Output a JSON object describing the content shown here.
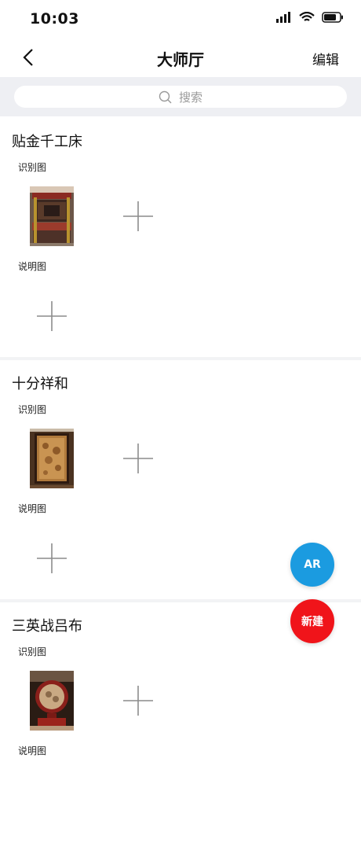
{
  "status_bar": {
    "time": "10:03"
  },
  "nav": {
    "title": "大师厅",
    "edit_label": "编辑"
  },
  "search": {
    "placeholder": "搜索"
  },
  "sections": [
    {
      "title": "贴金千工床",
      "recognition_label": "识别图",
      "description_label": "说明图"
    },
    {
      "title": "十分祥和",
      "recognition_label": "识别图",
      "description_label": "说明图"
    },
    {
      "title": "三英战吕布",
      "recognition_label": "识别图",
      "description_label": "说明图"
    }
  ],
  "fabs": {
    "ar_label": "AR",
    "new_label": "新建"
  },
  "colors": {
    "ar": "#1b9be0",
    "new": "#f0141a",
    "search_band": "#eeeff3"
  }
}
